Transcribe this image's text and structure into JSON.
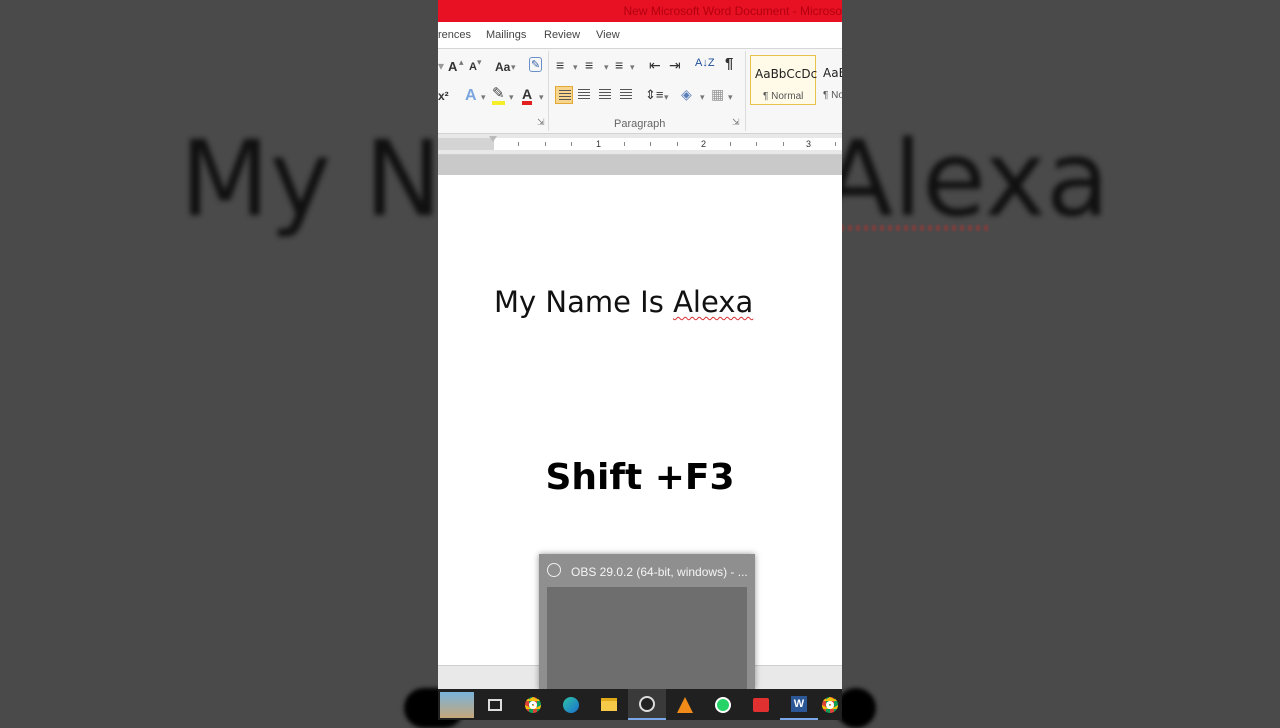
{
  "background": {
    "blurred_text": "My Name Is Alexa"
  },
  "window": {
    "title": "New Microsoft Word Document - Microso",
    "title_color": "#e81123"
  },
  "tabs": [
    "rences",
    "Mailings",
    "Review",
    "View"
  ],
  "ribbon": {
    "font_grow": "A",
    "font_shrink": "A",
    "change_case": "Aa",
    "superscript": "x²",
    "text_effects": "A",
    "font_color": "A",
    "paragraph_group_label": "Paragraph",
    "paragraph_mark": "¶",
    "sort": "A↓Z",
    "styles": [
      {
        "sample": "AaBbCcDc",
        "name": "¶ Normal",
        "selected": true
      },
      {
        "sample": "AaB",
        "name": "¶ No",
        "selected": false
      }
    ]
  },
  "ruler": {
    "numbers": [
      "1",
      "2",
      "3"
    ]
  },
  "document": {
    "text_before": "My Name Is ",
    "text_misspelled": "Alexa"
  },
  "overlay_caption": "Shift +F3",
  "taskbar_preview": {
    "caption": "OBS 29.0.2 (64-bit, windows) - ..."
  },
  "taskbar": {
    "apps": [
      {
        "icon": "landmark-wallpaper-icon"
      },
      {
        "icon": "task-view-icon"
      },
      {
        "icon": "chrome-icon"
      },
      {
        "icon": "edge-icon"
      },
      {
        "icon": "file-explorer-icon"
      },
      {
        "icon": "obs-icon",
        "active": true
      },
      {
        "icon": "vlc-icon"
      },
      {
        "icon": "whatsapp-icon"
      },
      {
        "icon": "anydesk-icon"
      },
      {
        "icon": "word-icon",
        "active": true
      },
      {
        "icon": "chrome-icon"
      }
    ],
    "word_glyph": "W"
  }
}
